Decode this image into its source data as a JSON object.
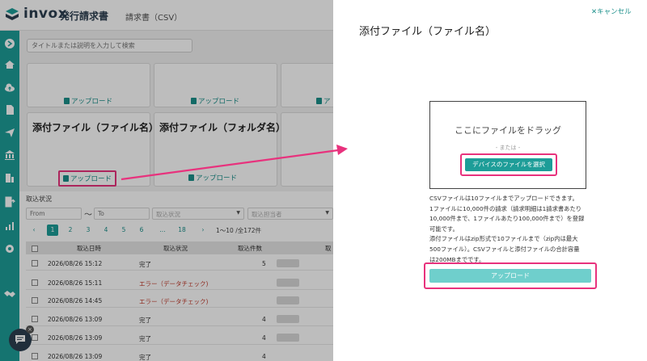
{
  "app": {
    "logo_text": "invox",
    "logo_sub": "発行請求書",
    "page_title": "請求書（CSV）"
  },
  "sidebar": {
    "icons": [
      "arrow-right-circle-icon",
      "home-icon",
      "cloud-upload-icon",
      "document-icon",
      "send-icon",
      "bank-icon",
      "building-icon",
      "export-icon",
      "chart-icon",
      "gear-icon",
      "handshake-icon"
    ]
  },
  "search": {
    "placeholder": "タイトルまたは説明を入力して検索"
  },
  "cards": {
    "upload_label": "アップロード",
    "attach_filename_title": "添付ファイル（ファイル名）",
    "attach_folder_title": "添付ファイル（フォルダ名）",
    "partial_label": "ア"
  },
  "status": {
    "heading": "取込状況",
    "from_placeholder": "From",
    "to_placeholder": "To",
    "tilde": "〜",
    "status_placeholder": "取込状況",
    "person_placeholder": "取込担当者",
    "pages": [
      "1",
      "2",
      "3",
      "4",
      "5",
      "6",
      "...",
      "18"
    ],
    "prev": "‹",
    "next": "›",
    "page_info": "1〜10 /全172件",
    "columns": [
      "取込日時",
      "取込状況",
      "取込件数",
      "取"
    ],
    "rows": [
      {
        "date": "2026/08/26 15:12",
        "status": "完了",
        "count": "5",
        "error": false
      },
      {
        "date": "2026/08/26 15:11",
        "status": "エラー（データチェック)",
        "count": "",
        "error": true
      },
      {
        "date": "2026/08/26 14:45",
        "status": "エラー（データチェック)",
        "count": "",
        "error": true
      },
      {
        "date": "2026/08/26 13:09",
        "status": "完了",
        "count": "4",
        "error": false
      },
      {
        "date": "2026/08/26 13:09",
        "status": "完了",
        "count": "4",
        "error": false
      },
      {
        "date": "2026/08/26 13:09",
        "status": "完了",
        "count": "4",
        "error": false
      }
    ]
  },
  "drawer": {
    "title": "添付ファイル（ファイル名）",
    "cancel": "キャンセル",
    "drop_text": "ここにファイルをドラッグ",
    "or_text": "- または -",
    "select_button": "デバイスのファイルを選択",
    "info_lines": [
      "CSVファイルは10ファイルまでアップロードできます。",
      "1ファイルに10,000件の請求（請求明細は1請求書あたり",
      "10,000件まで、1ファイルあたり100,000件まで）を登録",
      "可能です。",
      "添付ファイルはzip形式で10ファイルまで（zip内は最大",
      "500ファイル）。CSVファイルと添付ファイルの合計容量",
      "は200MBまでです。"
    ],
    "upload_button": "アップロード"
  },
  "colors": {
    "accent": "#1d9d98",
    "highlight": "#e8327d",
    "error": "#c0392b"
  }
}
